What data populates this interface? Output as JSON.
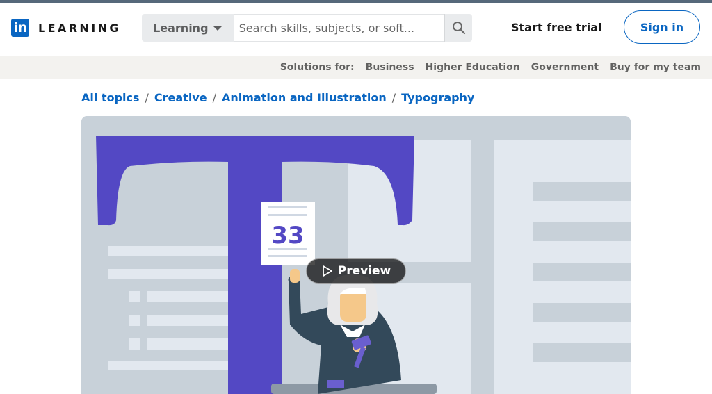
{
  "header": {
    "logo_glyph": "in",
    "logo_text": "LEARNING",
    "search_category": "Learning",
    "search_placeholder": "Search skills, subjects, or soft...",
    "start_trial": "Start free trial",
    "sign_in": "Sign in"
  },
  "solutions": {
    "label": "Solutions for:",
    "items": [
      "Business",
      "Higher Education",
      "Government",
      "Buy for my team"
    ]
  },
  "breadcrumb": [
    "All topics",
    "Creative",
    "Animation and Illustration",
    "Typography"
  ],
  "hero": {
    "card_number": "33",
    "preview_label": "Preview"
  },
  "colors": {
    "brand_blue": "#0a66c2",
    "hero_purple": "#5348c4"
  },
  "icons": {
    "search": "search-icon",
    "caret": "caret-down-icon",
    "play": "play-icon"
  }
}
